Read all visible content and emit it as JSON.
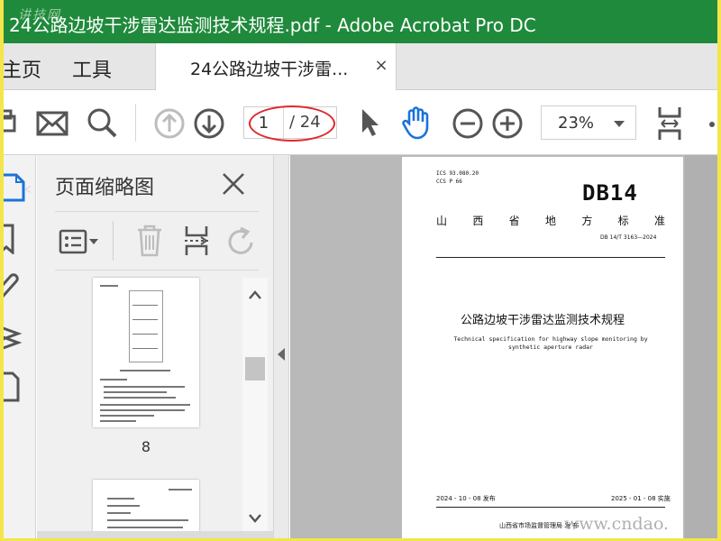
{
  "window": {
    "watermark_corner": "讲技网",
    "title": "24公路边坡干涉雷达监测技术规程.pdf - Adobe Acrobat Pro DC"
  },
  "tabs": {
    "home": "主页",
    "tools": "工具",
    "document": "24公路边坡干涉雷...",
    "close": "×"
  },
  "toolbar": {
    "page_current": "1",
    "page_total": "/ 24",
    "zoom": "23%"
  },
  "thumbnail_panel": {
    "title": "页面缩略图",
    "thumbs": [
      {
        "label": "8"
      }
    ]
  },
  "pdf_page": {
    "ics": "ICS 93.080.20",
    "ccs": "CCS P 66",
    "standard_mark": "DB14",
    "province_chars": [
      "山",
      "西",
      "省",
      "地",
      "方",
      "标",
      "准"
    ],
    "standard_number": "DB 14/T 3163—2024",
    "title_cn": "公路边坡干涉雷达监测技术规程",
    "title_en": "Technical specification for highway slope monitoring by synthetic aperture radar",
    "issue_date": "2024 - 10 - 08 发布",
    "effective_date": "2025 - 01 - 08 实施",
    "issuer": "山西省市场监督管理局   发 布"
  },
  "watermark": "www.cndao.",
  "colors": {
    "titlebar": "#1f8a3b",
    "accent_blue": "#1a73d9",
    "annotation_red": "#e0262b",
    "border_yellow": "#f3e54a"
  }
}
